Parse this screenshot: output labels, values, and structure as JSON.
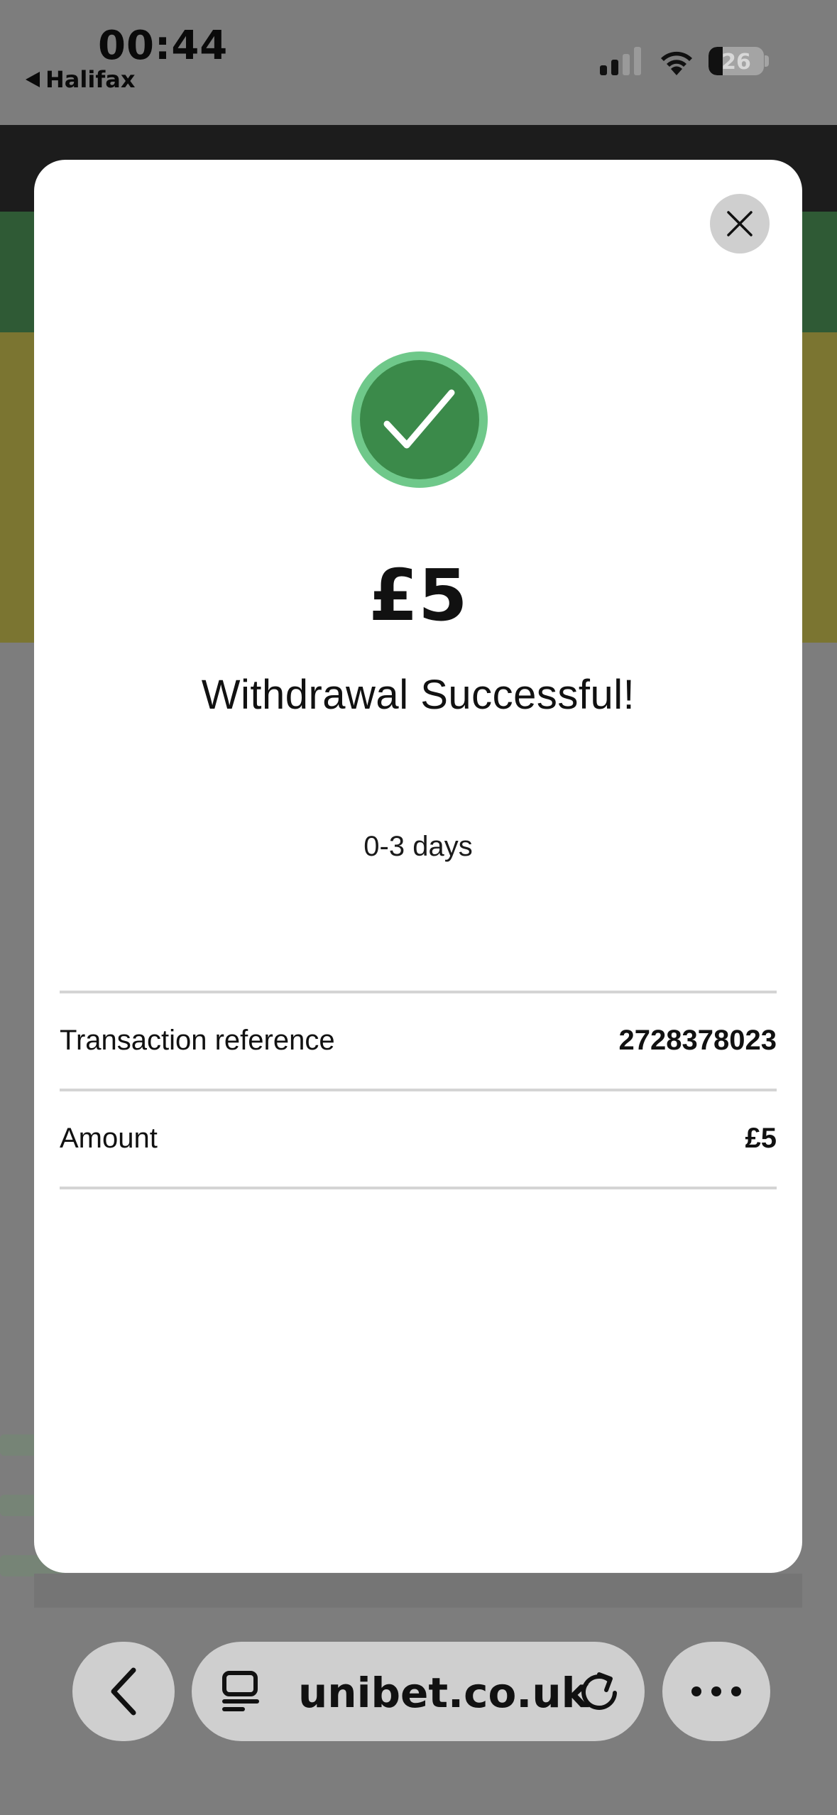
{
  "status_bar": {
    "time": "00:44",
    "back_app": "Halifax",
    "battery": "26",
    "signal_bars_active": 2,
    "signal_bars_total": 4,
    "battery_level": 0.26
  },
  "modal": {
    "amount": "£5",
    "title": "Withdrawal Successful!",
    "eta": "0-3 days",
    "details": [
      {
        "label": "Transaction reference",
        "value": "2728378023"
      },
      {
        "label": "Amount",
        "value": "£5"
      }
    ],
    "icons": {
      "close": "close-icon",
      "status": "checkmark-circle-icon"
    },
    "colors": {
      "success_fill": "#3b8a4a",
      "success_ring": "#6fc88a"
    }
  },
  "browser": {
    "url": "unibet.co.uk",
    "icons": {
      "back": "chevron-left-icon",
      "tabs": "tab-overview-icon",
      "reload": "reload-icon",
      "more": "more-icon"
    }
  }
}
